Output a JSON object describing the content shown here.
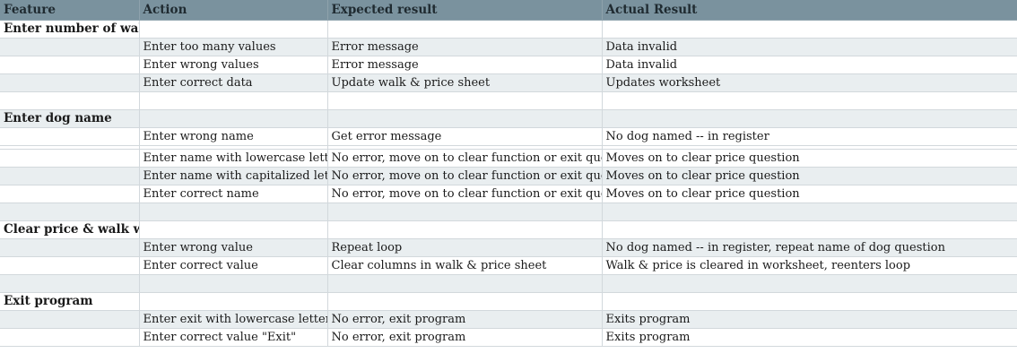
{
  "header": {
    "col1": "Feature",
    "col2": "Action",
    "col3": "Expected result",
    "col4": "Actual Result"
  },
  "rows": [
    [
      "Enter number of walks",
      "",
      "",
      ""
    ],
    [
      "",
      "Enter too many values",
      "Error message",
      "Data invalid"
    ],
    [
      "",
      "Enter wrong values",
      "Error message",
      "Data invalid"
    ],
    [
      "",
      "Enter correct data",
      "Update walk & price sheet",
      "Updates worksheet"
    ],
    [
      "",
      "",
      "",
      ""
    ],
    [
      "Enter dog name",
      "",
      "",
      ""
    ],
    [
      "",
      "Enter wrong name",
      "Get error message",
      "No dog named -- in register"
    ],
    [
      "",
      "Enter name with lowercase letters",
      "No error, move on to clear function or exit question",
      "Moves on to clear price question"
    ],
    [
      "",
      "Enter name with capitalized letter",
      "No error, move on to clear function or exit question",
      "Moves on to clear price question"
    ],
    [
      "",
      "Enter correct name",
      "No error, move on to clear function or exit question",
      "Moves on to clear price question"
    ],
    [
      "",
      "",
      "",
      ""
    ],
    [
      "Clear price & walk worksheet",
      "",
      "",
      ""
    ],
    [
      "",
      "Enter wrong value",
      "Repeat loop",
      "No dog named -- in register, repeat name of dog question"
    ],
    [
      "",
      "Enter correct value",
      "Clear columns in walk & price sheet",
      "Walk & price is cleared in worksheet, reenters loop"
    ],
    [
      "",
      "",
      "",
      ""
    ],
    [
      "Exit program",
      "",
      "",
      ""
    ],
    [
      "",
      "Enter exit with lowercase letters",
      "No error, exit program",
      "Exits program"
    ],
    [
      "",
      "Enter correct value \"Exit\"",
      "No error, exit program",
      "Exits program"
    ]
  ]
}
